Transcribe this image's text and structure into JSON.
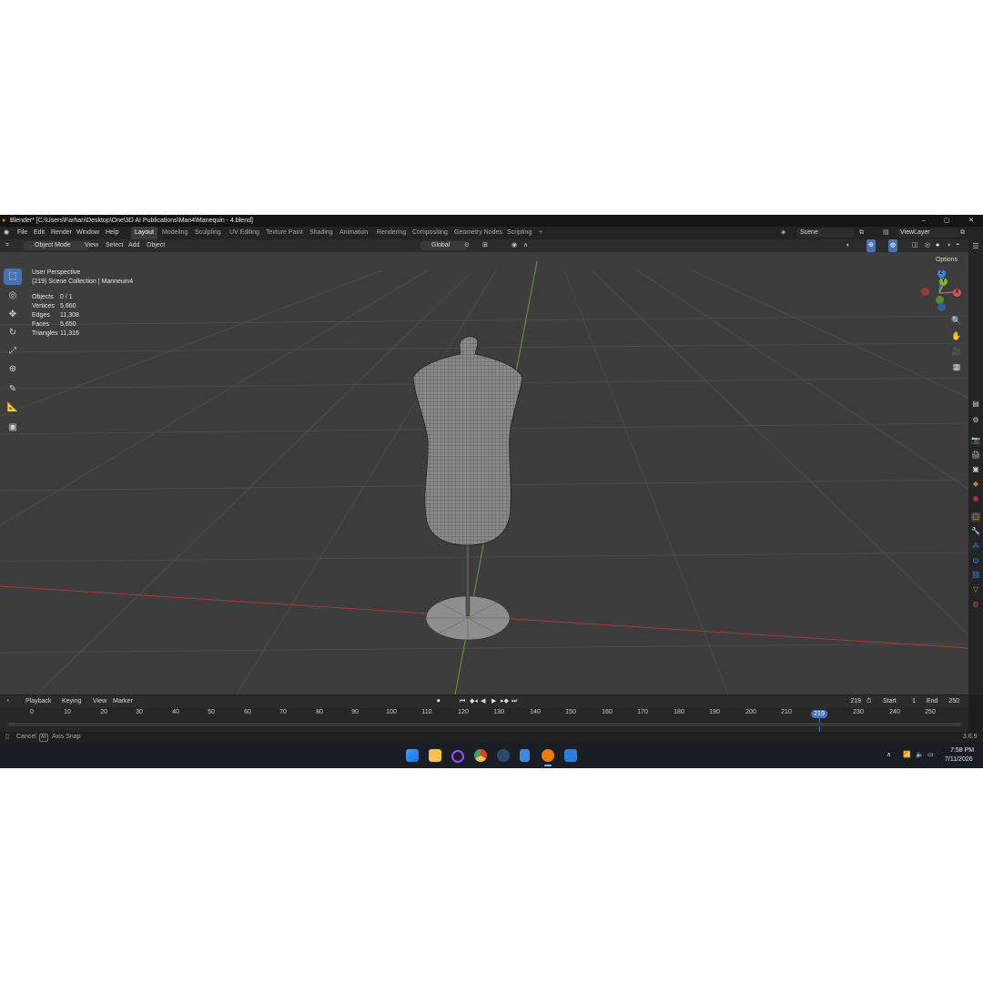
{
  "window": {
    "title": "Blender* [C:\\Users\\Farhan\\Desktop\\One\\3D AI Publications\\Man4\\Manequin - 4.blend]",
    "controls": [
      "–",
      "▢",
      "✕"
    ]
  },
  "menu": [
    "File",
    "Edit",
    "Render",
    "Window",
    "Help"
  ],
  "workspaces": [
    "Layout",
    "Modeling",
    "Sculpting",
    "UV Editing",
    "Texture Paint",
    "Shading",
    "Animation",
    "Rendering",
    "Compositing",
    "Geometry Nodes",
    "Scripting",
    "+"
  ],
  "active_workspace": "Layout",
  "scene": {
    "label": "Scene",
    "view_layer": "ViewLayer"
  },
  "viewport_header": {
    "mode": "Object Mode",
    "menus": [
      "View",
      "Select",
      "Add",
      "Object"
    ],
    "orientation": "Global",
    "options": "Options"
  },
  "viewport": {
    "perspective": "User Perspective",
    "collection": "(219) Scene Collection | Manneuin4",
    "stats": [
      {
        "label": "Objects",
        "value": "0 / 1"
      },
      {
        "label": "Vertices",
        "value": "5,660"
      },
      {
        "label": "Edges",
        "value": "11,308"
      },
      {
        "label": "Faces",
        "value": "5,650"
      },
      {
        "label": "Triangles",
        "value": "11,316"
      }
    ],
    "gizmo": {
      "z": "Z",
      "y": "Y",
      "x": "X"
    }
  },
  "timeline": {
    "menus": [
      "Playback",
      "Keying",
      "View",
      "Marker"
    ],
    "current_frame": "219",
    "start_label": "Start",
    "start": "1",
    "end_label": "End",
    "end": "250",
    "ticks": [
      "0",
      "10",
      "20",
      "30",
      "40",
      "50",
      "60",
      "70",
      "80",
      "90",
      "100",
      "110",
      "120",
      "130",
      "140",
      "150",
      "160",
      "170",
      "180",
      "190",
      "200",
      "210",
      "230",
      "240",
      "250"
    ],
    "marker": "219"
  },
  "statusbar": {
    "cancel": "Cancel",
    "axis_snap": "Axis Snap",
    "version": "3.6.9"
  },
  "taskbar": {
    "time": "7:58 PM",
    "date": "7/11/2026"
  },
  "colors": {
    "accent": "#4772b3",
    "x_axis": "#e05050",
    "y_axis": "#7fb33a",
    "z_axis": "#3b83e0"
  }
}
